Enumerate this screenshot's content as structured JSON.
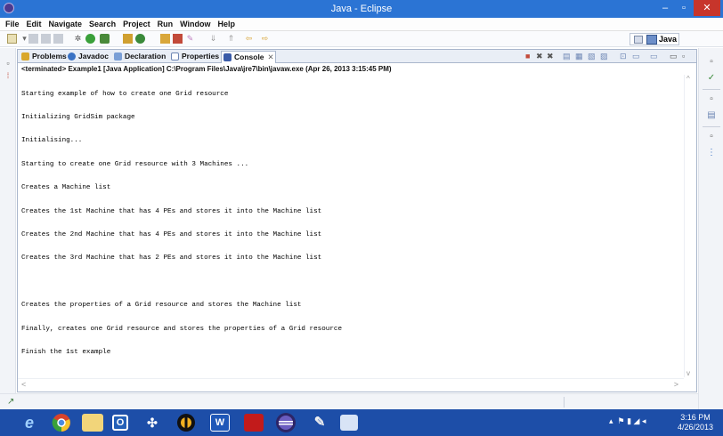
{
  "window": {
    "title": "Java - Eclipse",
    "minimize": "–",
    "maximize": "▫",
    "close": "✕"
  },
  "menu": [
    "File",
    "Edit",
    "Navigate",
    "Search",
    "Project",
    "Run",
    "Window",
    "Help"
  ],
  "perspective": {
    "label": "Java"
  },
  "tabs": [
    {
      "label": "Problems",
      "icon": "problems-icon",
      "color": "#d9a72c"
    },
    {
      "label": "Javadoc",
      "icon": "javadoc-icon",
      "color": "#3a72c4"
    },
    {
      "label": "Declaration",
      "icon": "declaration-icon",
      "color": "#7a9fd6"
    },
    {
      "label": "Properties",
      "icon": "properties-icon",
      "color": "#8aa8d8"
    },
    {
      "label": "Console",
      "icon": "console-icon",
      "color": "#3a5ba8",
      "active": true,
      "close": "✕"
    }
  ],
  "console": {
    "header": "<terminated> Example1 [Java Application] C:\\Program Files\\Java\\jre7\\bin\\javaw.exe (Apr 26, 2013 3:15:45 PM)",
    "lines": [
      "Starting example of how to create one Grid resource",
      "Initializing GridSim package",
      "Initialising...",
      "Starting to create one Grid resource with 3 Machines ...",
      "Creates a Machine list",
      "Creates the 1st Machine that has 4 PEs and stores it into the Machine list",
      "Creates the 2nd Machine that has 4 PEs and stores it into the Machine list",
      "Creates the 3rd Machine that has 2 PEs and stores it into the Machine list",
      "",
      "Creates the properties of a Grid resource and stores the Machine list",
      "Finally, creates one Grid resource and stores the properties of a Grid resource",
      "Finish the 1st example"
    ]
  },
  "taskbar": {
    "apps": [
      "ie-icon",
      "chrome-icon",
      "explorer-icon",
      "outlook-icon",
      "cmd-icon",
      "jade-icon",
      "word-icon",
      "pdf-icon",
      "eclipse-icon",
      "paint-icon",
      "image-icon"
    ],
    "word_label": "W",
    "outlook_label": "O"
  },
  "clock": {
    "time": "3:16 PM",
    "date": "4/26/2013"
  },
  "colors": {
    "titlebar": "#2b74d4",
    "taskbar": "#1d4ea8",
    "close": "#c7352b"
  }
}
